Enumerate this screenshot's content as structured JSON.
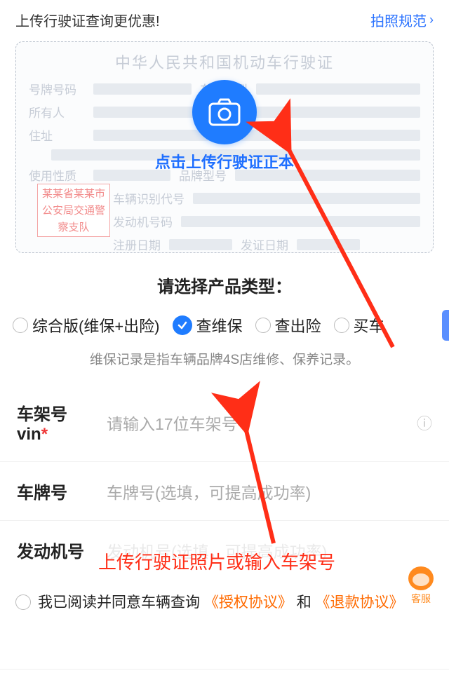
{
  "header": {
    "promo": "上传行驶证查询更优惠!",
    "photo_spec": "拍照规范"
  },
  "card": {
    "title": "中华人民共和国机动车行驶证",
    "labels": {
      "plate": "号牌号码",
      "type": "车辆类型",
      "owner": "所有人",
      "address": "住址",
      "usage": "使用性质",
      "brand": "品牌型号",
      "vin": "车辆识别代号",
      "engine": "发动机号码",
      "reg_date": "注册日期",
      "issue_date": "发证日期"
    },
    "stamp": "某某省某某市公安局交通警察支队",
    "upload_text": "点击上传行驶证正本"
  },
  "section_title": "请选择产品类型：",
  "product_types": {
    "options": [
      {
        "label": "综合版(维保+出险)",
        "selected": false
      },
      {
        "label": "查维保",
        "selected": true
      },
      {
        "label": "查出险",
        "selected": false
      },
      {
        "label": "买车",
        "selected": false
      }
    ],
    "hint": "维保记录是指车辆品牌4S店维修、保养记录。"
  },
  "inputs": {
    "vin": {
      "label": "车架号vin",
      "required": "*",
      "placeholder": "请输入17位车架号"
    },
    "plate": {
      "label": "车牌号",
      "placeholder": "车牌号(选填，可提高成功率)"
    },
    "engine": {
      "label": "发动机号",
      "placeholder": "发动机号(选填，可提高成功率)"
    }
  },
  "annotation": {
    "text": "上传行驶证照片或输入车架号"
  },
  "agreement": {
    "pre": "我已阅读并同意车辆查询",
    "link1": "《授权协议》",
    "mid": "和",
    "link2": "《退款协议》"
  },
  "cs": {
    "label": "客服"
  }
}
